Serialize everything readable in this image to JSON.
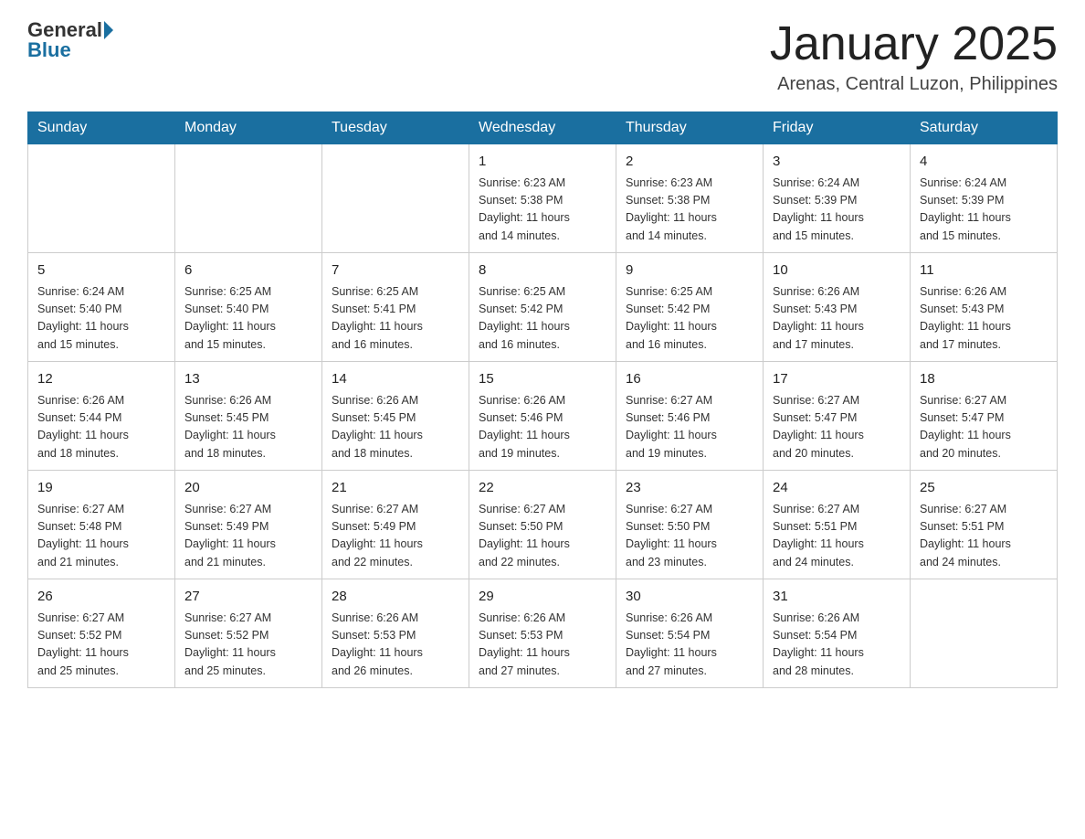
{
  "header": {
    "logo_general": "General",
    "logo_blue": "Blue",
    "month": "January 2025",
    "location": "Arenas, Central Luzon, Philippines"
  },
  "weekdays": [
    "Sunday",
    "Monday",
    "Tuesday",
    "Wednesday",
    "Thursday",
    "Friday",
    "Saturday"
  ],
  "weeks": [
    [
      {
        "day": "",
        "info": ""
      },
      {
        "day": "",
        "info": ""
      },
      {
        "day": "",
        "info": ""
      },
      {
        "day": "1",
        "info": "Sunrise: 6:23 AM\nSunset: 5:38 PM\nDaylight: 11 hours\nand 14 minutes."
      },
      {
        "day": "2",
        "info": "Sunrise: 6:23 AM\nSunset: 5:38 PM\nDaylight: 11 hours\nand 14 minutes."
      },
      {
        "day": "3",
        "info": "Sunrise: 6:24 AM\nSunset: 5:39 PM\nDaylight: 11 hours\nand 15 minutes."
      },
      {
        "day": "4",
        "info": "Sunrise: 6:24 AM\nSunset: 5:39 PM\nDaylight: 11 hours\nand 15 minutes."
      }
    ],
    [
      {
        "day": "5",
        "info": "Sunrise: 6:24 AM\nSunset: 5:40 PM\nDaylight: 11 hours\nand 15 minutes."
      },
      {
        "day": "6",
        "info": "Sunrise: 6:25 AM\nSunset: 5:40 PM\nDaylight: 11 hours\nand 15 minutes."
      },
      {
        "day": "7",
        "info": "Sunrise: 6:25 AM\nSunset: 5:41 PM\nDaylight: 11 hours\nand 16 minutes."
      },
      {
        "day": "8",
        "info": "Sunrise: 6:25 AM\nSunset: 5:42 PM\nDaylight: 11 hours\nand 16 minutes."
      },
      {
        "day": "9",
        "info": "Sunrise: 6:25 AM\nSunset: 5:42 PM\nDaylight: 11 hours\nand 16 minutes."
      },
      {
        "day": "10",
        "info": "Sunrise: 6:26 AM\nSunset: 5:43 PM\nDaylight: 11 hours\nand 17 minutes."
      },
      {
        "day": "11",
        "info": "Sunrise: 6:26 AM\nSunset: 5:43 PM\nDaylight: 11 hours\nand 17 minutes."
      }
    ],
    [
      {
        "day": "12",
        "info": "Sunrise: 6:26 AM\nSunset: 5:44 PM\nDaylight: 11 hours\nand 18 minutes."
      },
      {
        "day": "13",
        "info": "Sunrise: 6:26 AM\nSunset: 5:45 PM\nDaylight: 11 hours\nand 18 minutes."
      },
      {
        "day": "14",
        "info": "Sunrise: 6:26 AM\nSunset: 5:45 PM\nDaylight: 11 hours\nand 18 minutes."
      },
      {
        "day": "15",
        "info": "Sunrise: 6:26 AM\nSunset: 5:46 PM\nDaylight: 11 hours\nand 19 minutes."
      },
      {
        "day": "16",
        "info": "Sunrise: 6:27 AM\nSunset: 5:46 PM\nDaylight: 11 hours\nand 19 minutes."
      },
      {
        "day": "17",
        "info": "Sunrise: 6:27 AM\nSunset: 5:47 PM\nDaylight: 11 hours\nand 20 minutes."
      },
      {
        "day": "18",
        "info": "Sunrise: 6:27 AM\nSunset: 5:47 PM\nDaylight: 11 hours\nand 20 minutes."
      }
    ],
    [
      {
        "day": "19",
        "info": "Sunrise: 6:27 AM\nSunset: 5:48 PM\nDaylight: 11 hours\nand 21 minutes."
      },
      {
        "day": "20",
        "info": "Sunrise: 6:27 AM\nSunset: 5:49 PM\nDaylight: 11 hours\nand 21 minutes."
      },
      {
        "day": "21",
        "info": "Sunrise: 6:27 AM\nSunset: 5:49 PM\nDaylight: 11 hours\nand 22 minutes."
      },
      {
        "day": "22",
        "info": "Sunrise: 6:27 AM\nSunset: 5:50 PM\nDaylight: 11 hours\nand 22 minutes."
      },
      {
        "day": "23",
        "info": "Sunrise: 6:27 AM\nSunset: 5:50 PM\nDaylight: 11 hours\nand 23 minutes."
      },
      {
        "day": "24",
        "info": "Sunrise: 6:27 AM\nSunset: 5:51 PM\nDaylight: 11 hours\nand 24 minutes."
      },
      {
        "day": "25",
        "info": "Sunrise: 6:27 AM\nSunset: 5:51 PM\nDaylight: 11 hours\nand 24 minutes."
      }
    ],
    [
      {
        "day": "26",
        "info": "Sunrise: 6:27 AM\nSunset: 5:52 PM\nDaylight: 11 hours\nand 25 minutes."
      },
      {
        "day": "27",
        "info": "Sunrise: 6:27 AM\nSunset: 5:52 PM\nDaylight: 11 hours\nand 25 minutes."
      },
      {
        "day": "28",
        "info": "Sunrise: 6:26 AM\nSunset: 5:53 PM\nDaylight: 11 hours\nand 26 minutes."
      },
      {
        "day": "29",
        "info": "Sunrise: 6:26 AM\nSunset: 5:53 PM\nDaylight: 11 hours\nand 27 minutes."
      },
      {
        "day": "30",
        "info": "Sunrise: 6:26 AM\nSunset: 5:54 PM\nDaylight: 11 hours\nand 27 minutes."
      },
      {
        "day": "31",
        "info": "Sunrise: 6:26 AM\nSunset: 5:54 PM\nDaylight: 11 hours\nand 28 minutes."
      },
      {
        "day": "",
        "info": ""
      }
    ]
  ]
}
